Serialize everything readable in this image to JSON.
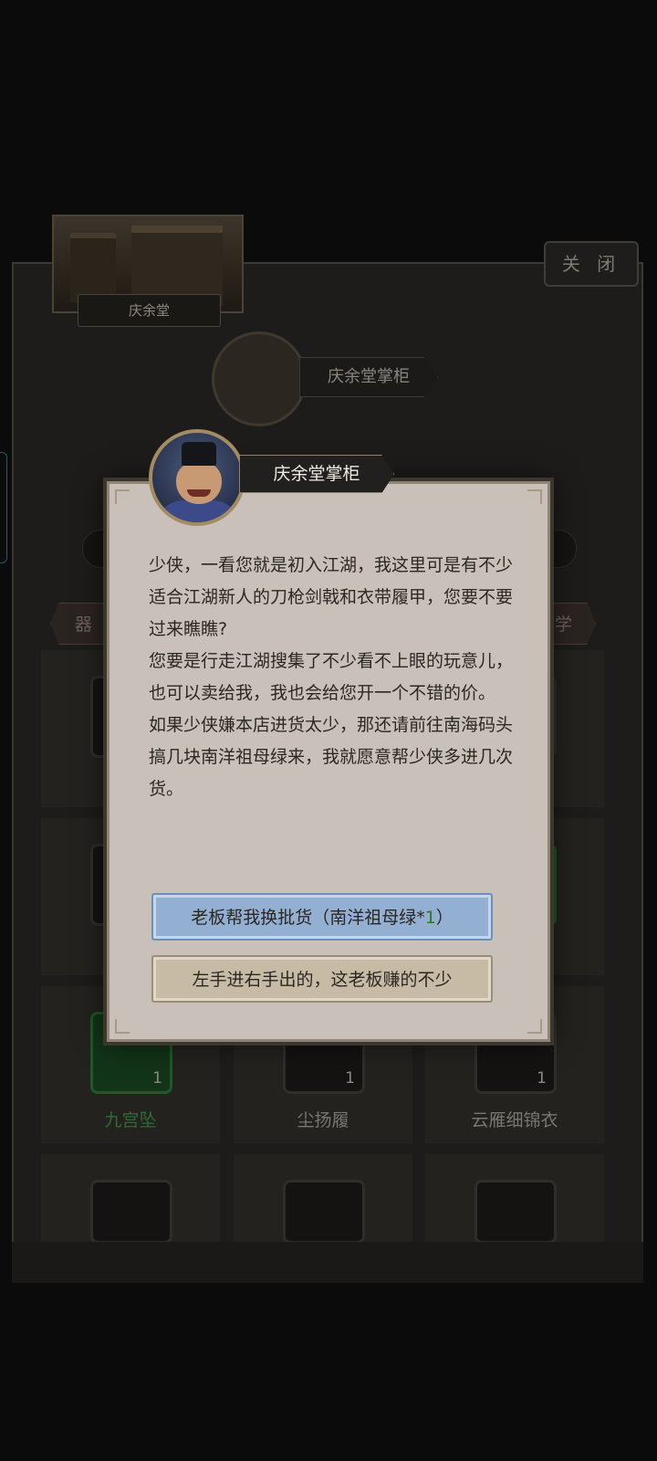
{
  "shop": {
    "location_label": "庆余堂",
    "close_label": "关 闭",
    "keeper_name": "庆余堂掌柜",
    "tabs": {
      "left": "器",
      "right": "学"
    },
    "items": [
      {
        "name": "九宫坠",
        "count": "1",
        "rarity": "green"
      },
      {
        "name": "尘扬履",
        "count": "1",
        "rarity": "normal"
      },
      {
        "name": "云雁细锦衣",
        "count": "1",
        "rarity": "normal"
      }
    ]
  },
  "dialog": {
    "speaker": "庆余堂掌柜",
    "paragraphs": [
      "少侠，一看您就是初入江湖，我这里可是有不少适合江湖新人的刀枪剑戟和衣带履甲，您要不要过来瞧瞧?",
      "您要是行走江湖搜集了不少看不上眼的玩意儿，也可以卖给我，我也会给您开一个不错的价。",
      "如果少侠嫌本店进货太少，那还请前往南海码头搞几块南洋祖母绿来，我就愿意帮少侠多进几次货。"
    ],
    "primary_button": {
      "label_prefix": "老板帮我换批货（南洋祖母绿*",
      "count": "1",
      "label_suffix": "）"
    },
    "secondary_button_label": "左手进右手出的，这老板赚的不少"
  },
  "colors": {
    "dialog_bg": "#c9c1b9",
    "primary_button": "#93afd1",
    "secondary_button": "#c8bba6",
    "accent_green": "#2a7a2a"
  }
}
